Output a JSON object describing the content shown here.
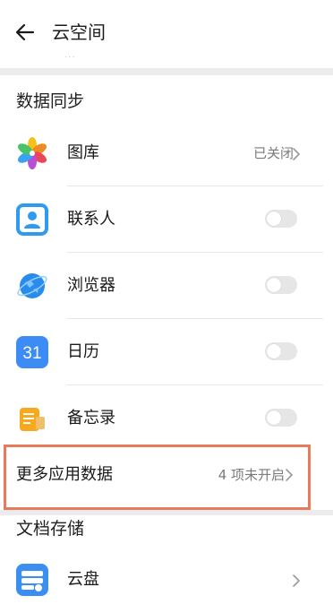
{
  "header": {
    "title": "云空间"
  },
  "sync_section": {
    "title": "数据同步",
    "items": [
      {
        "label": "图库",
        "status": "已关闭",
        "icon": "pinwheel-gallery-icon"
      },
      {
        "label": "联系人",
        "icon": "contacts-person-icon",
        "toggle_on": false
      },
      {
        "label": "浏览器",
        "icon": "browser-globe-icon",
        "toggle_on": false
      },
      {
        "label": "日历",
        "icon": "calendar-icon",
        "icon_text": "31",
        "toggle_on": false
      },
      {
        "label": "备忘录",
        "icon": "notepad-icon",
        "toggle_on": false
      }
    ]
  },
  "more_data": {
    "label": "更多应用数据",
    "status": "4 项未开启"
  },
  "docs_section": {
    "title": "文档存储",
    "items": [
      {
        "label": "云盘",
        "icon": "cloud-drive-icon"
      }
    ]
  },
  "colors": {
    "highlight_border": "#e8795a",
    "toggle_off": "#e6e6e6",
    "calendar_blue": "#3d8cf5"
  }
}
